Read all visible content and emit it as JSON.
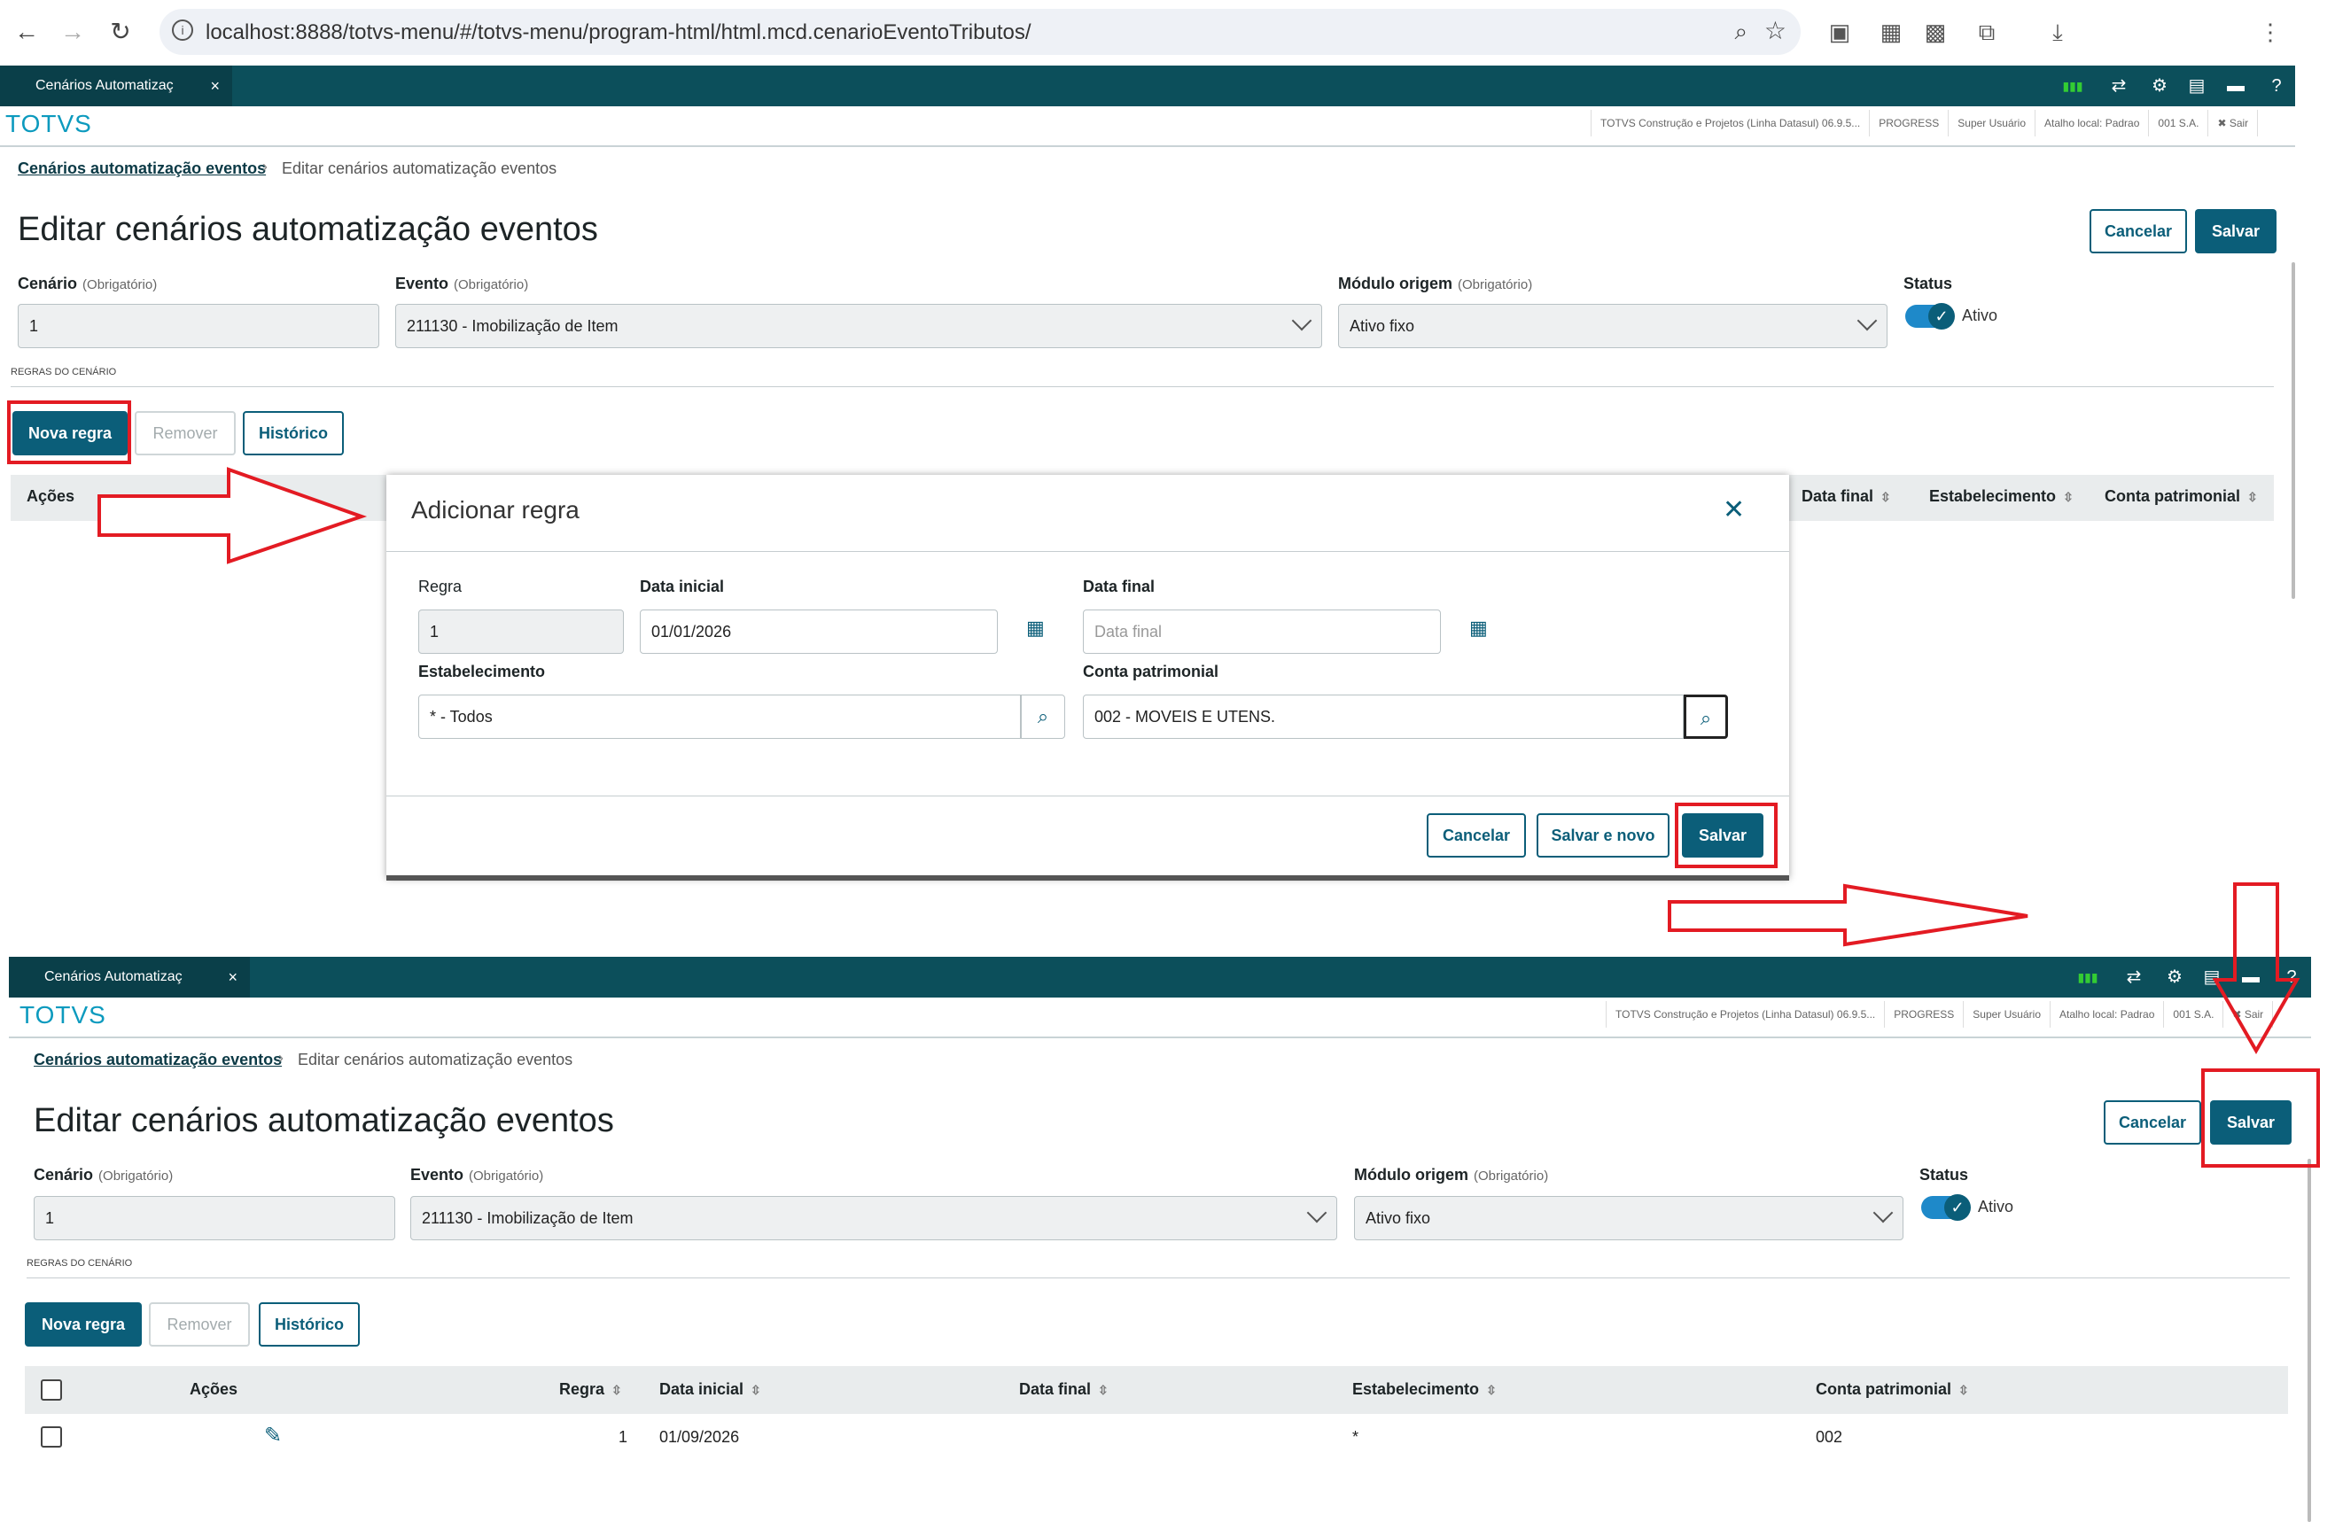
{
  "browser": {
    "url": "localhost:8888/totvs-menu/#/totvs-menu/program-html/html.mcd.cenarioEventoTributos/"
  },
  "app": {
    "tab_label": "Cenários Automatizaç",
    "tab_close": "×",
    "brand": "TOTVS",
    "info": [
      "TOTVS Construção e Projetos (Linha Datasul) 06.9.5...",
      "PROGRESS",
      "Super Usuário",
      "Atalho local: Padrao",
      "001 S.A."
    ],
    "logout": "✖ Sair",
    "signal_label": "DI"
  },
  "breadcrumb": {
    "parent": "Cenários automatização eventos",
    "separator": "›",
    "current": "Editar cenários automatização eventos"
  },
  "page": {
    "title": "Editar cenários automatização eventos",
    "cancel_label": "Cancelar",
    "save_label": "Salvar"
  },
  "form": {
    "cenario_label": "Cenário",
    "required_hint": "(Obrigatório)",
    "cenario_value": "1",
    "evento_label": "Evento",
    "evento_value": "211130 - Imobilização de Item",
    "modulo_label": "Módulo origem",
    "modulo_value": "Ativo fixo",
    "status_label": "Status",
    "status_value": "Ativo"
  },
  "rules": {
    "section_label": "REGRAS DO CENÁRIO",
    "new_label": "Nova regra",
    "remove_label": "Remover",
    "history_label": "Histórico",
    "columns": [
      "Ações",
      "Regra",
      "Data inicial",
      "Data final",
      "Estabelecimento",
      "Conta patrimonial"
    ],
    "rows": [
      {
        "regra": "1",
        "data_inicial": "01/09/2026",
        "data_final": "",
        "estabelecimento": "*",
        "conta": "002"
      }
    ]
  },
  "modal": {
    "title": "Adicionar regra",
    "regra_label": "Regra",
    "regra_value": "1",
    "data_inicial_label": "Data inicial",
    "data_inicial_value": "01/01/2026",
    "data_final_label": "Data final",
    "data_final_placeholder": "Data final",
    "estab_label": "Estabelecimento",
    "estab_value": "* - Todos",
    "conta_label": "Conta patrimonial",
    "conta_value": "002 - MOVEIS E UTENS.",
    "cancel_label": "Cancelar",
    "save_new_label": "Salvar e novo",
    "save_label": "Salvar"
  },
  "colors": {
    "primary": "#0b5e79",
    "header": "#0c4f5b",
    "brand": "#0c9abe",
    "annotation": "#e31b23"
  }
}
